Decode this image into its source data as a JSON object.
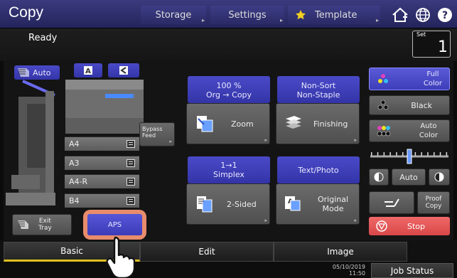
{
  "header": {
    "title": "Copy",
    "tabs": [
      {
        "label": "Storage"
      },
      {
        "label": "Settings"
      },
      {
        "label": "Template"
      }
    ]
  },
  "status": {
    "text": "Ready",
    "set_label": "Set",
    "set_value": "1"
  },
  "original_mode_tray": {
    "auto_label": "Auto",
    "bypass_label": "Bypass\nFeed",
    "exit_tray_label": "Exit\nTray",
    "aps_label": "APS"
  },
  "trays": [
    {
      "label": "A4"
    },
    {
      "label": "A3"
    },
    {
      "label": "A4-R"
    },
    {
      "label": "B4"
    }
  ],
  "functions": {
    "zoom_value": "100 %\nOrg  →  Copy",
    "zoom_label": "Zoom",
    "finishing_value": "Non-Sort\nNon-Staple",
    "finishing_label": "Finishing",
    "sided_value": "1→1\nSimplex",
    "sided_label": "2-Sided",
    "mode_value": "Text/Photo",
    "mode_label": "Original\nMode"
  },
  "color": {
    "full_color": "Full\nColor",
    "black": "Black",
    "auto_color": "Auto\nColor",
    "density_auto": "Auto",
    "proof_copy": "Proof\nCopy",
    "stop": "Stop",
    "density_level": 0.5
  },
  "bottom_tabs": [
    {
      "label": "Basic"
    },
    {
      "label": "Edit"
    },
    {
      "label": "Image"
    }
  ],
  "footer": {
    "date": "05/10/2019",
    "time": "11:50",
    "job_status": "Job Status"
  },
  "colors": {
    "accent_blue": "#3838b0",
    "stop_red": "#e05050",
    "aps_highlight": "#e88c6c",
    "tab_underline": "#e0c020"
  }
}
